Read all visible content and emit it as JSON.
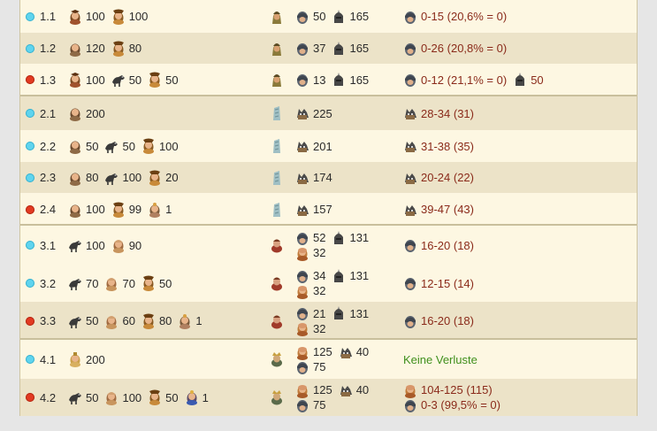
{
  "rows": [
    {
      "id": "1.1",
      "status": "blue",
      "units": [
        {
          "icon": "bowman-icon",
          "n": "100"
        },
        {
          "icon": "longbowman-icon",
          "n": "100"
        }
      ],
      "foe_icon": "bandit-chief-icon",
      "enemy": [
        [
          {
            "icon": "bandit-icon",
            "n": "50"
          },
          {
            "icon": "knight-icon",
            "n": "165"
          }
        ]
      ],
      "loss": [
        [
          {
            "icon": "bandit-icon",
            "t": "0-15 (20,6% = 0)"
          }
        ]
      ]
    },
    {
      "id": "1.2",
      "status": "blue",
      "units": [
        {
          "icon": "recruit-icon",
          "n": "120"
        },
        {
          "icon": "longbowman-icon",
          "n": "80"
        }
      ],
      "foe_icon": "bandit-chief-icon",
      "enemy": [
        [
          {
            "icon": "bandit-icon",
            "n": "37"
          },
          {
            "icon": "knight-icon",
            "n": "165"
          }
        ]
      ],
      "loss": [
        [
          {
            "icon": "bandit-icon",
            "t": "0-26 (20,8% = 0)"
          }
        ]
      ]
    },
    {
      "id": "1.3",
      "status": "red",
      "units": [
        {
          "icon": "bowman-icon",
          "n": "100"
        },
        {
          "icon": "cavalry-icon",
          "n": "50"
        },
        {
          "icon": "longbowman-icon",
          "n": "50"
        }
      ],
      "foe_icon": "bandit-chief-icon",
      "enemy": [
        [
          {
            "icon": "bandit-icon",
            "n": "13"
          },
          {
            "icon": "knight-icon",
            "n": "165"
          }
        ]
      ],
      "loss": [
        [
          {
            "icon": "bandit-icon",
            "t": "0-12 (21,1% = 0)"
          },
          {
            "icon": "knight-icon",
            "t": "50"
          }
        ]
      ]
    },
    {
      "id": "2.1",
      "status": "blue",
      "units": [
        {
          "icon": "recruit-icon",
          "n": "200"
        }
      ],
      "foe_icon": "stone-tower-icon",
      "enemy": [
        [
          {
            "icon": "wolf-icon",
            "n": "225"
          }
        ]
      ],
      "loss": [
        [
          {
            "icon": "wolf-icon",
            "t": "28-34 (31)"
          }
        ]
      ]
    },
    {
      "id": "2.2",
      "status": "blue",
      "units": [
        {
          "icon": "recruit-icon",
          "n": "50"
        },
        {
          "icon": "cavalry-icon",
          "n": "50"
        },
        {
          "icon": "longbowman-icon",
          "n": "100"
        }
      ],
      "foe_icon": "stone-tower-icon",
      "enemy": [
        [
          {
            "icon": "wolf-icon",
            "n": "201"
          }
        ]
      ],
      "loss": [
        [
          {
            "icon": "wolf-icon",
            "t": "31-38 (35)"
          }
        ]
      ]
    },
    {
      "id": "2.3",
      "status": "blue",
      "units": [
        {
          "icon": "recruit-icon",
          "n": "80"
        },
        {
          "icon": "cavalry-icon",
          "n": "100"
        },
        {
          "icon": "longbowman-icon",
          "n": "20"
        }
      ],
      "foe_icon": "stone-tower-icon",
      "enemy": [
        [
          {
            "icon": "wolf-icon",
            "n": "174"
          }
        ]
      ],
      "loss": [
        [
          {
            "icon": "wolf-icon",
            "t": "20-24 (22)"
          }
        ]
      ]
    },
    {
      "id": "2.4",
      "status": "red",
      "units": [
        {
          "icon": "recruit-icon",
          "n": "100"
        },
        {
          "icon": "longbowman-icon",
          "n": "99"
        },
        {
          "icon": "general-icon",
          "n": "1"
        }
      ],
      "foe_icon": "stone-tower-icon",
      "enemy": [
        [
          {
            "icon": "wolf-icon",
            "n": "157"
          }
        ]
      ],
      "loss": [
        [
          {
            "icon": "wolf-icon",
            "t": "39-47 (43)"
          }
        ]
      ]
    },
    {
      "id": "3.1",
      "status": "blue",
      "units": [
        {
          "icon": "cavalry-icon",
          "n": "100"
        },
        {
          "icon": "soldier-icon",
          "n": "90"
        }
      ],
      "foe_icon": "thug-leader-icon",
      "enemy": [
        [
          {
            "icon": "bandit-icon",
            "n": "52"
          },
          {
            "icon": "knight-icon",
            "n": "131"
          }
        ],
        [
          {
            "icon": "thug-icon",
            "n": "32"
          }
        ]
      ],
      "loss": [
        [
          {
            "icon": "bandit-icon",
            "t": "16-20 (18)"
          }
        ]
      ]
    },
    {
      "id": "3.2",
      "status": "blue",
      "units": [
        {
          "icon": "cavalry-icon",
          "n": "70"
        },
        {
          "icon": "soldier-icon",
          "n": "70"
        },
        {
          "icon": "longbowman-icon",
          "n": "50"
        }
      ],
      "foe_icon": "thug-leader-icon",
      "enemy": [
        [
          {
            "icon": "bandit-icon",
            "n": "34"
          },
          {
            "icon": "knight-icon",
            "n": "131"
          }
        ],
        [
          {
            "icon": "thug-icon",
            "n": "32"
          }
        ]
      ],
      "loss": [
        [
          {
            "icon": "bandit-icon",
            "t": "12-15 (14)"
          }
        ]
      ]
    },
    {
      "id": "3.3",
      "status": "red",
      "units": [
        {
          "icon": "cavalry-icon",
          "n": "50"
        },
        {
          "icon": "soldier-icon",
          "n": "60"
        },
        {
          "icon": "longbowman-icon",
          "n": "80"
        },
        {
          "icon": "general-icon",
          "n": "1"
        }
      ],
      "foe_icon": "thug-leader-icon",
      "enemy": [
        [
          {
            "icon": "bandit-icon",
            "n": "21"
          },
          {
            "icon": "knight-icon",
            "n": "131"
          }
        ],
        [
          {
            "icon": "thug-icon",
            "n": "32"
          }
        ]
      ],
      "loss": [
        [
          {
            "icon": "bandit-icon",
            "t": "16-20 (18)"
          }
        ]
      ]
    },
    {
      "id": "4.1",
      "status": "blue",
      "units": [
        {
          "icon": "archer-icon",
          "n": "200"
        }
      ],
      "foe_icon": "bandit-boss-icon",
      "enemy": [
        [
          {
            "icon": "thug-icon",
            "n": "125"
          },
          {
            "icon": "wolf-icon",
            "n": "40"
          }
        ],
        [
          {
            "icon": "bandit-icon",
            "n": "75"
          }
        ]
      ],
      "loss_ok": "Keine Verluste"
    },
    {
      "id": "4.2",
      "status": "red",
      "units": [
        {
          "icon": "cavalry-icon",
          "n": "50"
        },
        {
          "icon": "soldier-icon",
          "n": "100"
        },
        {
          "icon": "longbowman-icon",
          "n": "50"
        },
        {
          "icon": "general-blue-icon",
          "n": "1"
        }
      ],
      "foe_icon": "bandit-boss-icon",
      "enemy": [
        [
          {
            "icon": "thug-icon",
            "n": "125"
          },
          {
            "icon": "wolf-icon",
            "n": "40"
          }
        ],
        [
          {
            "icon": "bandit-icon",
            "n": "75"
          }
        ]
      ],
      "loss": [
        [
          {
            "icon": "thug-icon",
            "t": "104-125 (115)"
          }
        ],
        [
          {
            "icon": "bandit-icon",
            "t": "0-3 (99,5% = 0)"
          }
        ]
      ]
    }
  ],
  "colors": {
    "blue_dot": "#5fd4ee",
    "red_dot": "#e23a22",
    "loss_text": "#8a2a1a",
    "ok_text": "#3f8f1c"
  }
}
